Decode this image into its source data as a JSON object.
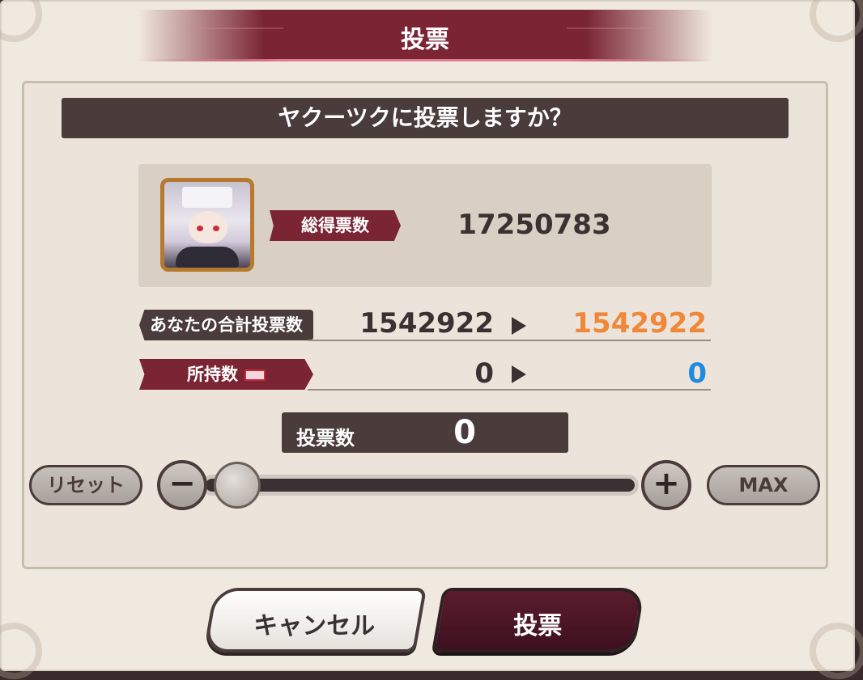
{
  "dialog": {
    "title": "投票",
    "question": "ヤクーツクに投票しますか？"
  },
  "character": {
    "total_votes_label": "総得票数",
    "total_votes": "17250783"
  },
  "stats": {
    "your_total_label": "あなたの合計投票数",
    "your_total_before": "1542922",
    "your_total_after": "1542922",
    "owned_label": "所持数",
    "owned_before": "0",
    "owned_after": "0"
  },
  "vote": {
    "count_label": "投票数",
    "count": "0",
    "slider_fraction": 0
  },
  "controls": {
    "reset_label": "リセット",
    "minus_label": "−",
    "plus_label": "+",
    "max_label": "MAX"
  },
  "buttons": {
    "cancel_label": "キャンセル",
    "vote_label": "投票"
  },
  "colors": {
    "accent": "#7a2434",
    "after_total": "#f0883a",
    "after_owned": "#1e8ae0"
  }
}
